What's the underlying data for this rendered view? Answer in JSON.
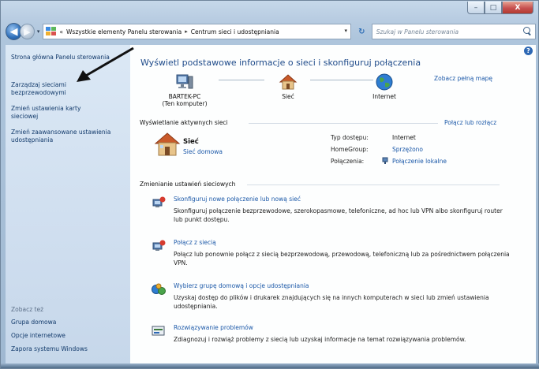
{
  "window": {
    "caption_min": "–",
    "caption_max": "□",
    "caption_close": "X"
  },
  "nav": {
    "back_glyph": "◀",
    "forward_glyph": "▶",
    "history_glyph": "▾",
    "breadcrumb_prefix": "«",
    "breadcrumb": [
      "Wszystkie elementy Panelu sterowania",
      "Centrum sieci i udostępniania"
    ],
    "breadcrumb_sep": "▸",
    "address_drop": "▾",
    "refresh_glyph": "↻",
    "search_placeholder": "Szukaj w Panelu sterowania"
  },
  "sidebar": {
    "links": [
      "Strona główna Panelu sterowania",
      "Zarządzaj sieciami bezprzewodowymi",
      "Zmień ustawienia karty sieciowej",
      "Zmień zaawansowane ustawienia udostępniania"
    ],
    "see_also_heading": "Zobacz też",
    "see_also": [
      "Grupa domowa",
      "Opcje internetowe",
      "Zapora systemu Windows"
    ]
  },
  "main": {
    "help_glyph": "?",
    "title": "Wyświetl podstawowe informacje o sieci i skonfiguruj połączenia",
    "full_map_link": "Zobacz pełną mapę",
    "map_nodes": {
      "computer": "BARTEK-PC",
      "computer_sub": "(Ten komputer)",
      "network": "Sieć",
      "internet": "Internet"
    },
    "active_heading": "Wyświetlanie aktywnych sieci",
    "connect_link": "Połącz lub rozłącz",
    "active_network": {
      "name": "Sieć",
      "type": "Sieć domowa",
      "access_label": "Typ dostępu:",
      "access_value": "Internet",
      "homegroup_label": "HomeGroup:",
      "homegroup_value": "Sprzężono",
      "connections_label": "Połączenia:",
      "connections_value": "Połączenie lokalne"
    },
    "change_heading": "Zmienianie ustawień sieciowych",
    "tasks": [
      {
        "title": "Skonfiguruj nowe połączenie lub nową sieć",
        "desc": "Skonfiguruj połączenie bezprzewodowe, szerokopasmowe, telefoniczne, ad hoc lub VPN albo skonfiguruj router lub punkt dostępu."
      },
      {
        "title": "Połącz z siecią",
        "desc": "Połącz lub ponownie połącz z siecią bezprzewodową, przewodową, telefoniczną lub za pośrednictwem połączenia VPN."
      },
      {
        "title": "Wybierz grupę domową i opcje udostępniania",
        "desc": "Uzyskaj dostęp do plików i drukarek znajdujących się na innych komputerach w sieci lub zmień ustawienia udostępniania."
      },
      {
        "title": "Rozwiązywanie problemów",
        "desc": "Zdiagnozuj i rozwiąż problemy z siecią lub uzyskaj informacje na temat rozwiązywania problemów."
      }
    ]
  }
}
